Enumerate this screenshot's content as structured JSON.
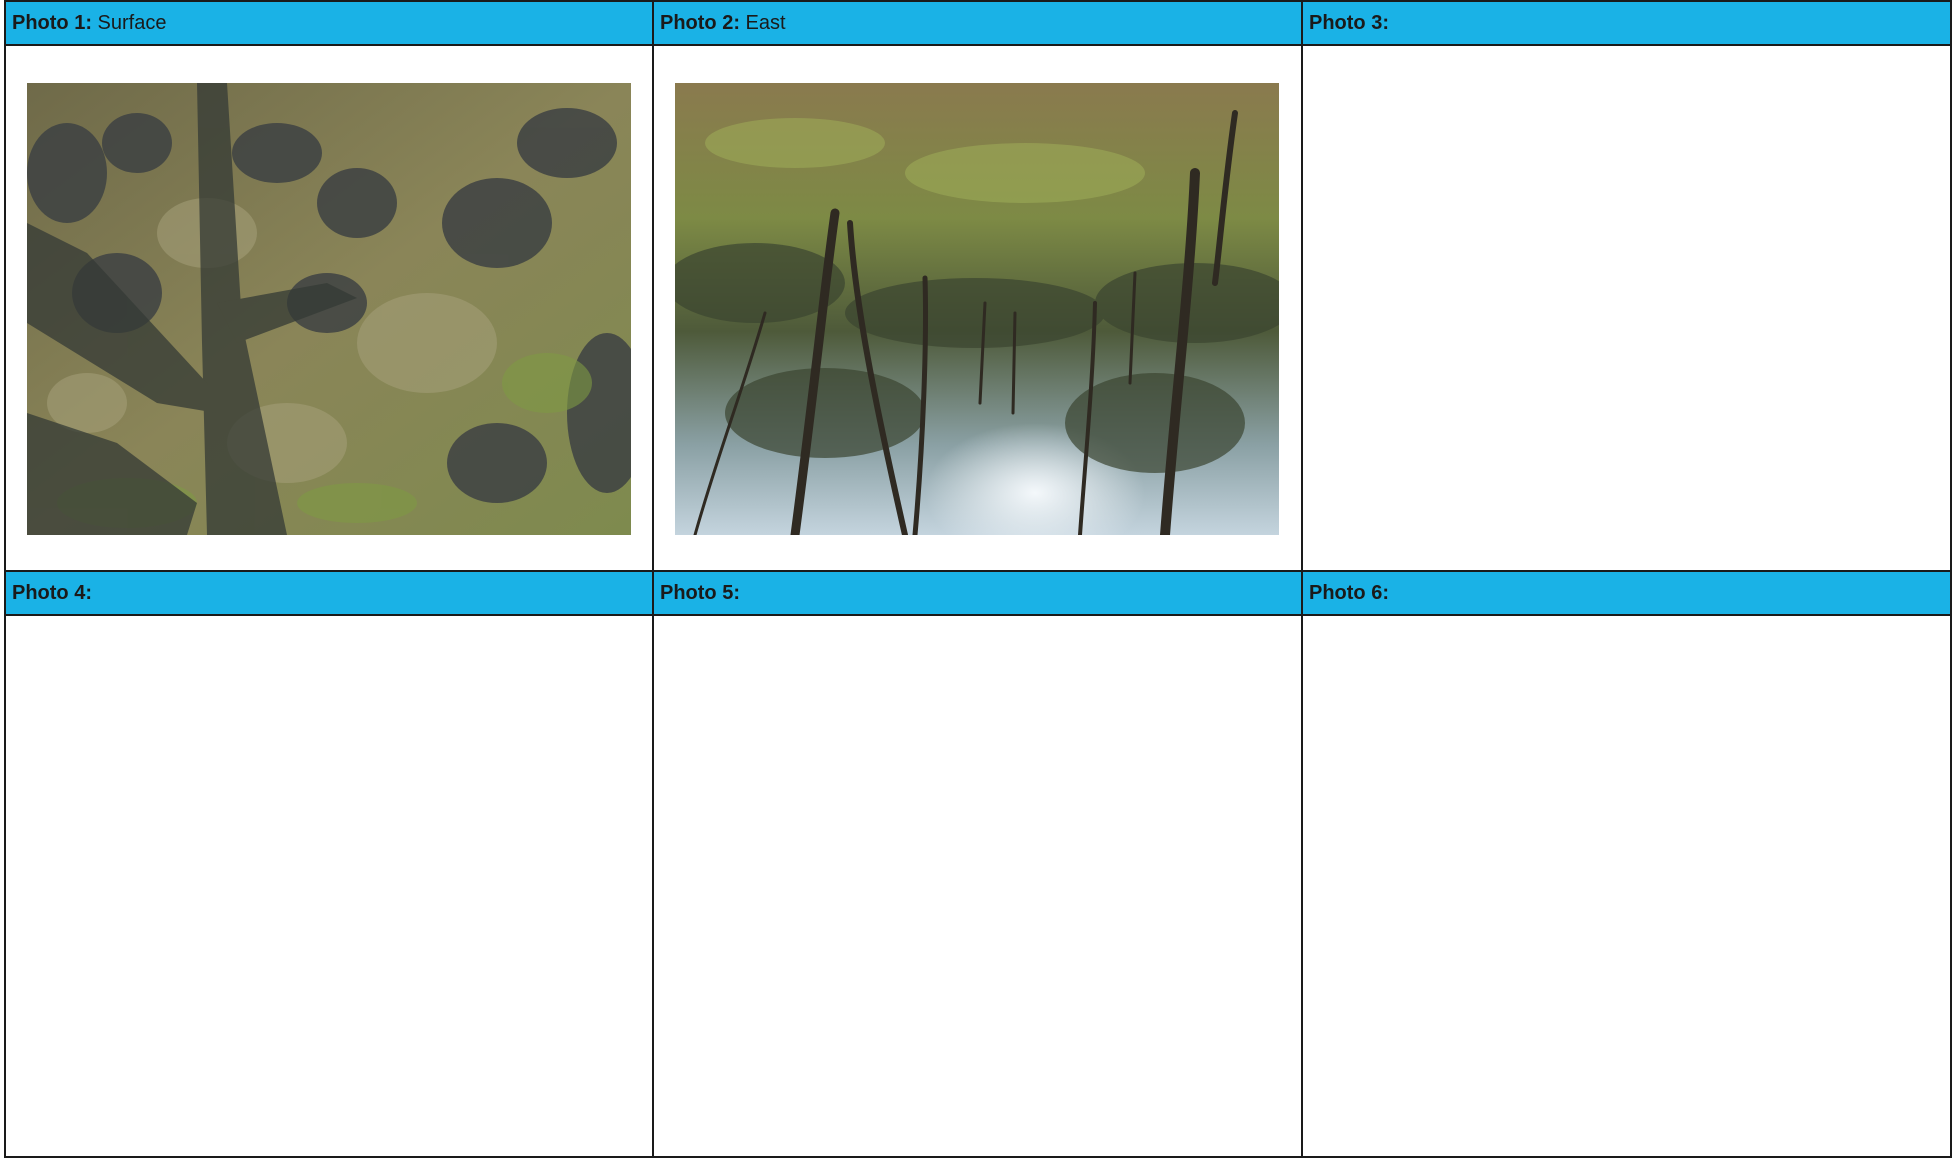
{
  "grid": {
    "rows": [
      {
        "cells": [
          {
            "label": "Photo 1:",
            "caption": " Surface",
            "has_photo": true,
            "photo_subject": "ground-surface"
          },
          {
            "label": "Photo 2:",
            "caption": " East",
            "has_photo": true,
            "photo_subject": "forest-east-inverted"
          },
          {
            "label": "Photo 3:",
            "caption": "",
            "has_photo": false
          }
        ]
      },
      {
        "cells": [
          {
            "label": "Photo 4:",
            "caption": "",
            "has_photo": false
          },
          {
            "label": "Photo 5:",
            "caption": "",
            "has_photo": false
          },
          {
            "label": "Photo 6:",
            "caption": "",
            "has_photo": false
          }
        ]
      }
    ]
  },
  "colors": {
    "header_background": "#1ab2e6",
    "border": "#1a1a1a",
    "text": "#1a1a1a"
  }
}
